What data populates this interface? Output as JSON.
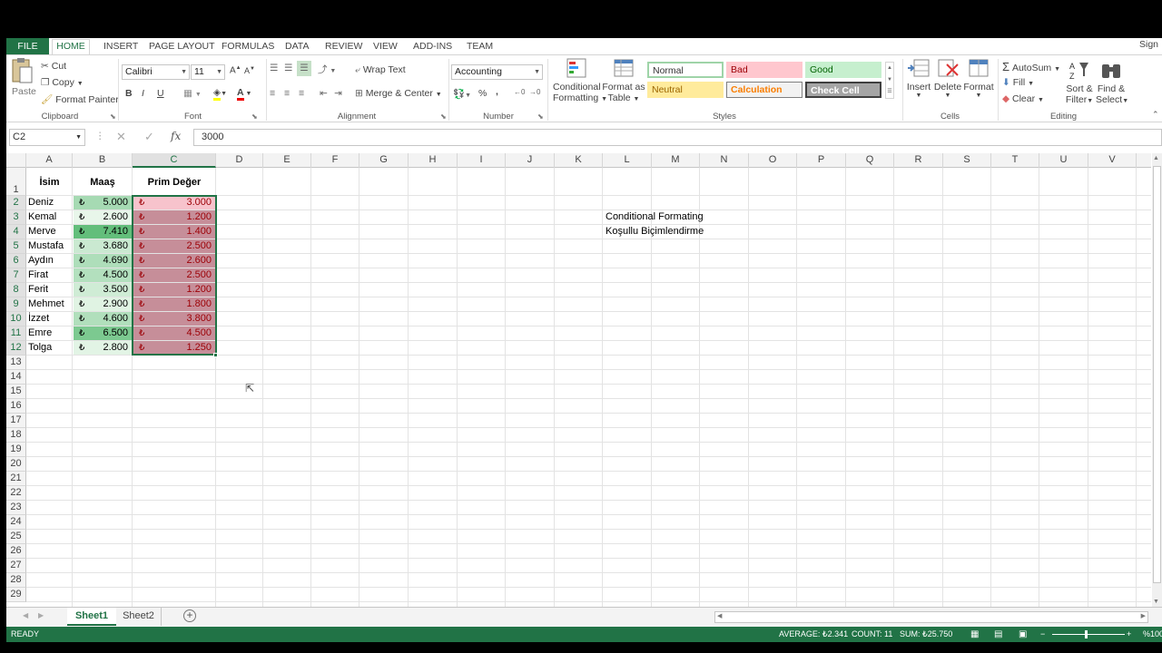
{
  "tabs": {
    "file": "FILE",
    "items": [
      "HOME",
      "INSERT",
      "PAGE LAYOUT",
      "FORMULAS",
      "DATA",
      "REVIEW",
      "VIEW",
      "ADD-INS",
      "TEAM"
    ],
    "signin": "Sign in"
  },
  "ribbon": {
    "clipboard": {
      "paste": "Paste",
      "cut": "Cut",
      "copy": "Copy",
      "format_painter": "Format Painter",
      "label": "Clipboard"
    },
    "font": {
      "name": "Calibri",
      "size": "11",
      "bold": "B",
      "italic": "I",
      "underline": "U",
      "label": "Font"
    },
    "alignment": {
      "wrap": "Wrap Text",
      "merge": "Merge & Center",
      "label": "Alignment"
    },
    "number": {
      "format": "Accounting",
      "percent": "%",
      "comma": ",",
      "label": "Number"
    },
    "styles": {
      "conditional": "Conditional",
      "conditional2": "Formatting",
      "format_table": "Format as",
      "format_table2": "Table",
      "normal": "Normal",
      "bad": "Bad",
      "good": "Good",
      "neutral": "Neutral",
      "calculation": "Calculation",
      "check": "Check Cell",
      "label": "Styles"
    },
    "cells": {
      "insert": "Insert",
      "delete": "Delete",
      "format": "Format",
      "label": "Cells"
    },
    "editing": {
      "autosum": "AutoSum",
      "fill": "Fill",
      "clear": "Clear",
      "sort": "Sort &",
      "sort2": "Filter",
      "find": "Find &",
      "find2": "Select",
      "label": "Editing"
    }
  },
  "formula_bar": {
    "name": "C2",
    "value": "3000",
    "fx": "fx"
  },
  "columns": [
    "A",
    "B",
    "C",
    "D",
    "E",
    "F",
    "G",
    "H",
    "I",
    "J",
    "K",
    "L",
    "M",
    "N",
    "O",
    "P",
    "Q",
    "R",
    "S",
    "T",
    "U",
    "V"
  ],
  "header_row": {
    "a": "İsim",
    "b": "Maaş",
    "c": "Prim Değer"
  },
  "rows": [
    {
      "n": "2",
      "name": "Deniz",
      "maas": "5.000",
      "prim": "3.000"
    },
    {
      "n": "3",
      "name": "Kemal",
      "maas": "2.600",
      "prim": "1.200"
    },
    {
      "n": "4",
      "name": "Merve",
      "maas": "7.410",
      "prim": "1.400"
    },
    {
      "n": "5",
      "name": "Mustafa",
      "maas": "3.680",
      "prim": "2.500"
    },
    {
      "n": "6",
      "name": "Aydın",
      "maas": "4.690",
      "prim": "2.600"
    },
    {
      "n": "7",
      "name": "Firat",
      "maas": "4.500",
      "prim": "2.500"
    },
    {
      "n": "8",
      "name": "Ferit",
      "maas": "3.500",
      "prim": "1.200"
    },
    {
      "n": "9",
      "name": "Mehmet",
      "maas": "2.900",
      "prim": "1.800"
    },
    {
      "n": "10",
      "name": "İzzet",
      "maas": "4.600",
      "prim": "3.800"
    },
    {
      "n": "11",
      "name": "Emre",
      "maas": "6.500",
      "prim": "4.500"
    },
    {
      "n": "12",
      "name": "Tolga",
      "maas": "2.800",
      "prim": "1.250"
    }
  ],
  "currency": "₺",
  "empty_rows": [
    "13",
    "14",
    "15",
    "16",
    "17",
    "18",
    "19",
    "20",
    "21",
    "22",
    "23",
    "24",
    "25",
    "26",
    "27",
    "28",
    "29"
  ],
  "notes": {
    "l3": "Conditional Formating",
    "l4": "Koşullu Biçimlendirme"
  },
  "sheets": [
    "Sheet1",
    "Sheet2"
  ],
  "status": {
    "ready": "READY",
    "average": "AVERAGE: ₺2.341",
    "count": "COUNT: 11",
    "sum": "SUM: ₺25.750",
    "zoom": "%100"
  },
  "colors": {
    "accent": "#217346",
    "bad_fill": "#c9909a",
    "good_fill": "#8fd19e"
  }
}
